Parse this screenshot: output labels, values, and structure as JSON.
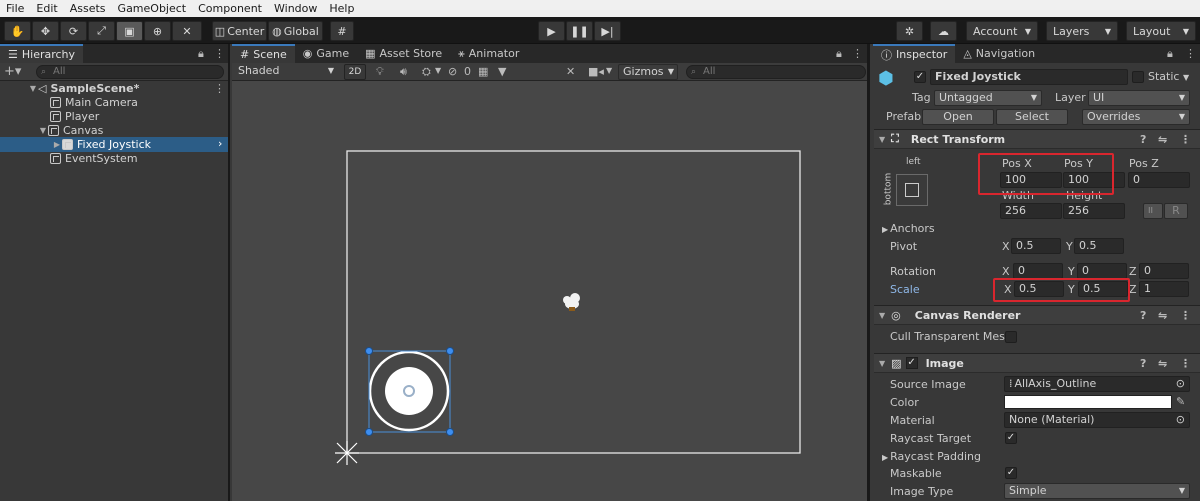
{
  "menu": [
    "File",
    "Edit",
    "Assets",
    "GameObject",
    "Component",
    "Window",
    "Help"
  ],
  "toolbar": {
    "tools": [
      "hand-icon",
      "move-icon",
      "rotate-icon",
      "scale-icon",
      "rect-tool-icon",
      "transform-icon",
      "custom-tool-icon"
    ],
    "pivot": "Center",
    "space": "Global",
    "account": "Account",
    "layers": "Layers",
    "layout": "Layout"
  },
  "hierarchy": {
    "tab": "Hierarchy",
    "search_placeholder": "All",
    "scene": "SampleScene*",
    "items": [
      "Main Camera",
      "Player",
      "Canvas",
      "Fixed Joystick",
      "EventSystem"
    ]
  },
  "scene_view": {
    "tabs": [
      "Scene",
      "Game",
      "Asset Store",
      "Animator"
    ],
    "shading": "Shaded",
    "mode2d": "2D",
    "gizmo_count": "0",
    "gizmos": "Gizmos",
    "search_placeholder": "All"
  },
  "inspector": {
    "tabs": [
      "Inspector",
      "Navigation"
    ],
    "object_name": "Fixed Joystick",
    "static": "Static",
    "tag_label": "Tag",
    "tag": "Untagged",
    "layer_label": "Layer",
    "layer": "UI",
    "prefab_label": "Prefab",
    "open": "Open",
    "select": "Select",
    "overrides": "Overrides",
    "rect": {
      "title": "Rect Transform",
      "anchor_h": "left",
      "anchor_v": "bottom",
      "posx_label": "Pos X",
      "posy_label": "Pos Y",
      "posz_label": "Pos Z",
      "posx": "100",
      "posy": "100",
      "posz": "0",
      "width_label": "Width",
      "height_label": "Height",
      "width": "256",
      "height": "256",
      "r_btn": "R",
      "anchors": "Anchors",
      "pivot": "Pivot",
      "pivot_x": "0.5",
      "pivot_y": "0.5",
      "rotation": "Rotation",
      "rot_x": "0",
      "rot_y": "0",
      "rot_z": "0",
      "scale": "Scale",
      "scale_x": "0.5",
      "scale_y": "0.5",
      "scale_z": "1",
      "x": "X",
      "y": "Y",
      "z": "Z"
    },
    "canvas_renderer": {
      "title": "Canvas Renderer",
      "cull": "Cull Transparent Mesh"
    },
    "image": {
      "title": "Image",
      "source_label": "Source Image",
      "source": "AllAxis_Outline",
      "color_label": "Color",
      "material_label": "Material",
      "material": "None (Material)",
      "raycast_target": "Raycast Target",
      "raycast_padding": "Raycast Padding",
      "maskable": "Maskable",
      "image_type_label": "Image Type",
      "image_type": "Simple"
    }
  },
  "colors": {
    "highlight": "#d9262e",
    "selection": "#2c5d87",
    "accent": "#3a79bb"
  }
}
